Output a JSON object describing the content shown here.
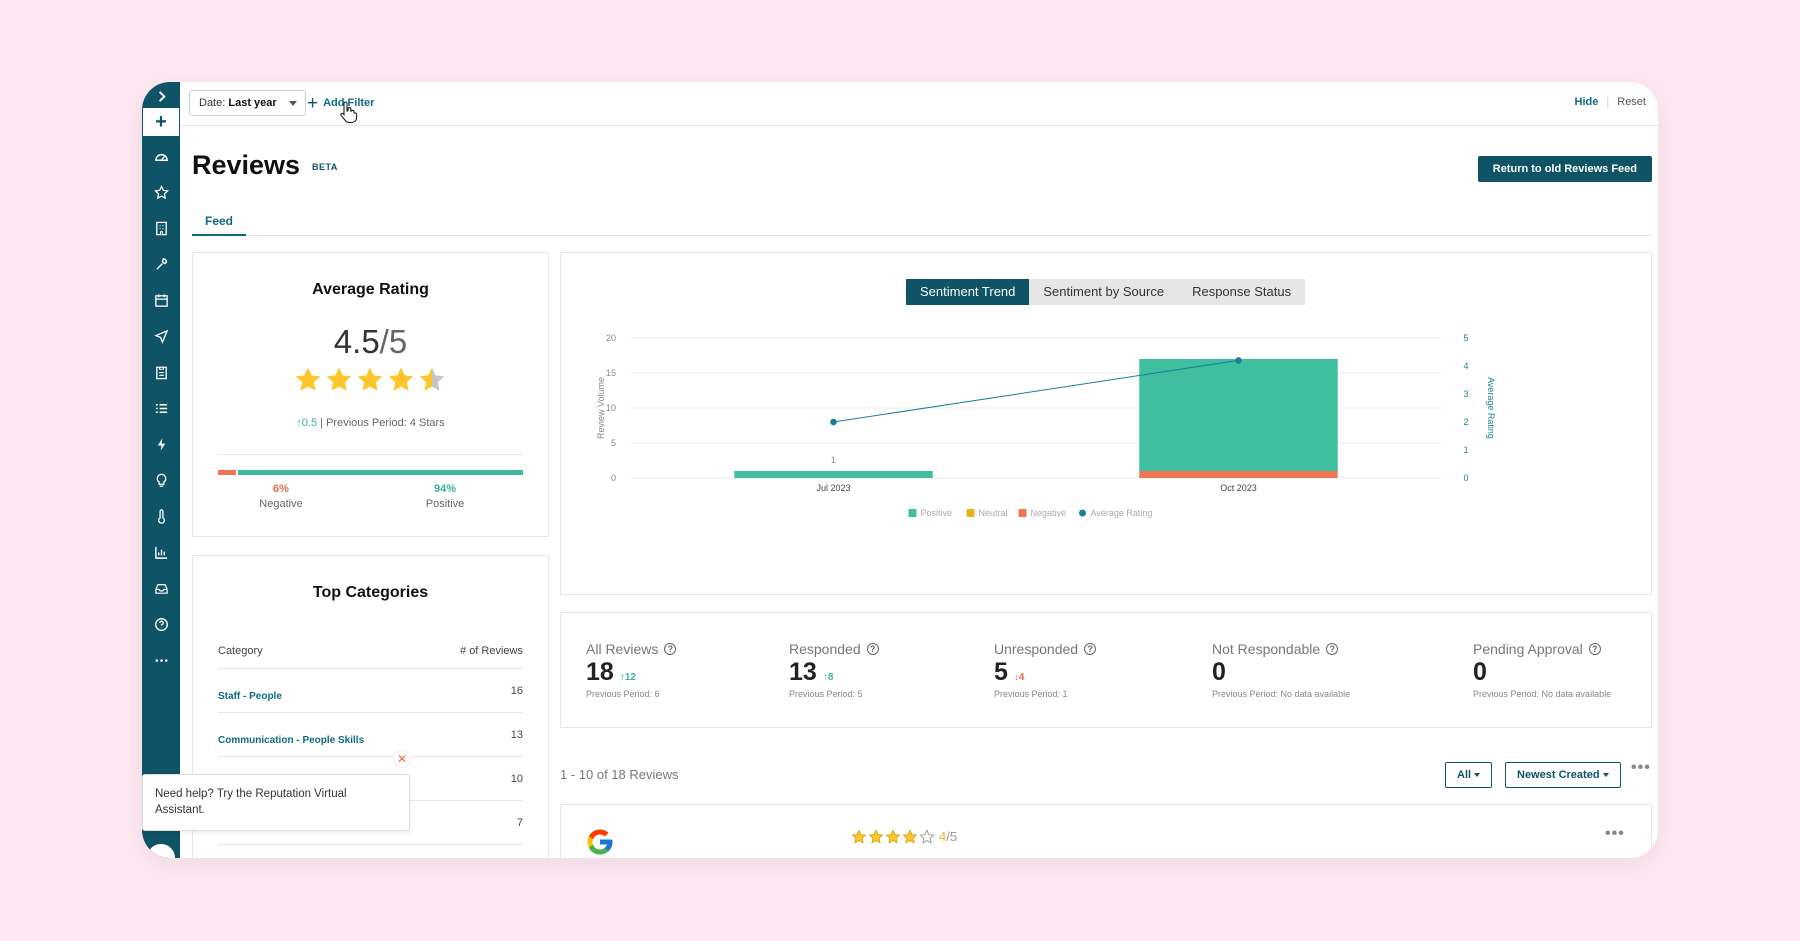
{
  "topbar": {
    "date_prefix": "Date:",
    "date_value": "Last year",
    "add_filter": "Add Filter",
    "hide": "Hide",
    "reset": "Reset"
  },
  "page": {
    "title": "Reviews",
    "badge": "BETA",
    "return_button": "Return to old Reviews Feed",
    "tab": "Feed"
  },
  "average_rating": {
    "title": "Average Rating",
    "value": "4.5",
    "denominator": "/5",
    "stars": 4.5,
    "change": "0.5",
    "previous": "| Previous Period: 4 Stars",
    "negative_pct": "6%",
    "negative_label": "Negative",
    "positive_pct": "94%",
    "positive_label": "Positive",
    "negative_share": 0.06
  },
  "top_categories": {
    "title": "Top Categories",
    "col_category": "Category",
    "col_reviews": "# of Reviews",
    "rows": [
      {
        "name": "Staff - People",
        "count": "16"
      },
      {
        "name": "Communication - People Skills",
        "count": "13"
      },
      {
        "name": "",
        "count": "10"
      },
      {
        "name": "",
        "count": "7"
      }
    ]
  },
  "chart_tabs": [
    "Sentiment Trend",
    "Sentiment by Source",
    "Response Status"
  ],
  "chart_data": {
    "type": "bar",
    "categories": [
      "Jul 2023",
      "Oct 2023"
    ],
    "series": [
      {
        "name": "Positive",
        "values": [
          1,
          16
        ],
        "color": "#3fbf9f"
      },
      {
        "name": "Neutral",
        "values": [
          0,
          0
        ],
        "color": "#e8b21c"
      },
      {
        "name": "Negative",
        "values": [
          0,
          1
        ],
        "color": "#ee7651"
      },
      {
        "name": "Average Rating",
        "values": [
          2,
          4.2
        ],
        "color": "#1a7f99",
        "axis": "right"
      }
    ],
    "bar_labels": [
      "1",
      ""
    ],
    "ylabel": "Review Volume",
    "ylabel_right": "Average Rating",
    "ylim": [
      0,
      20
    ],
    "yticks": [
      0,
      5,
      10,
      15,
      20
    ],
    "ylim_right": [
      0,
      5
    ],
    "yticks_right": [
      0,
      1,
      2,
      3,
      4,
      5
    ],
    "grid": true,
    "legend": "bottom"
  },
  "stats": [
    {
      "label": "All Reviews",
      "value": "18",
      "delta": "12",
      "dir": "up",
      "prev": "Previous Period: 6"
    },
    {
      "label": "Responded",
      "value": "13",
      "delta": "8",
      "dir": "up",
      "prev": "Previous Period: 5"
    },
    {
      "label": "Unresponded",
      "value": "5",
      "delta": "4",
      "dir": "down",
      "prev": "Previous Period: 1"
    },
    {
      "label": "Not Respondable",
      "value": "0",
      "delta": "",
      "dir": "",
      "prev": "Previous Period: No data available"
    },
    {
      "label": "Pending Approval",
      "value": "0",
      "delta": "",
      "dir": "",
      "prev": "Previous Period: No data available"
    }
  ],
  "list": {
    "count_text": "1 - 10 of 18 Reviews",
    "filter_all": "All",
    "sort": "Newest Created"
  },
  "review": {
    "rating": "4",
    "denominator": "/5",
    "stars": 4
  },
  "help": {
    "text": "Need help? Try the Reputation Virtual Assistant."
  },
  "colors": {
    "brand": "#0e5366",
    "positive": "#3fbf9f",
    "negative": "#ee7651",
    "neutral": "#e8b21c",
    "star": "#fcc72d"
  },
  "icons": [
    "expand-icon",
    "plus-icon",
    "dashboard-icon",
    "star-icon",
    "building-icon",
    "wrench-icon",
    "calendar-icon",
    "send-icon",
    "clipboard-icon",
    "list-icon",
    "bolt-icon",
    "bulb-icon",
    "thermometer-icon",
    "chart-icon",
    "inbox-icon",
    "help-icon",
    "more-icon"
  ]
}
